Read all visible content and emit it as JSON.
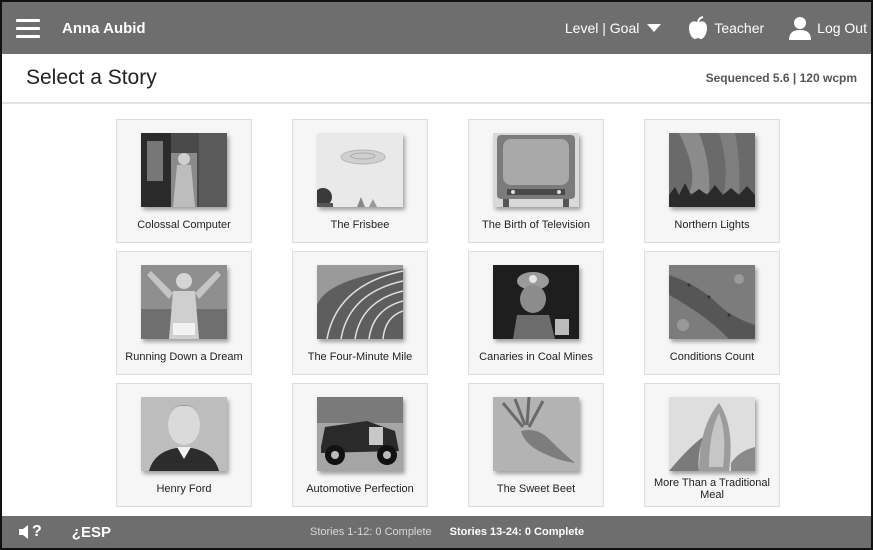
{
  "topbar": {
    "user_name": "Anna Aubid",
    "level_goal_label": "Level | Goal",
    "teacher_label": "Teacher",
    "logout_label": "Log Out"
  },
  "header": {
    "title": "Select a Story",
    "info": "Sequenced 5.6 | 120 wcpm"
  },
  "stories": [
    {
      "title": "Colossal Computer"
    },
    {
      "title": "The Frisbee"
    },
    {
      "title": "The Birth of Television"
    },
    {
      "title": "Northern Lights"
    },
    {
      "title": "Running Down a Dream"
    },
    {
      "title": "The Four-Minute Mile"
    },
    {
      "title": "Canaries in Coal Mines"
    },
    {
      "title": "Conditions Count"
    },
    {
      "title": "Henry Ford"
    },
    {
      "title": "Automotive Perfection"
    },
    {
      "title": "The Sweet Beet"
    },
    {
      "title": "More Than a Traditional Meal"
    }
  ],
  "bottombar": {
    "help_label": "?",
    "esp_label": "¿ESP",
    "progress_1": "Stories 1-12: 0 Complete",
    "progress_2": "Stories 13-24: 0 Complete"
  }
}
